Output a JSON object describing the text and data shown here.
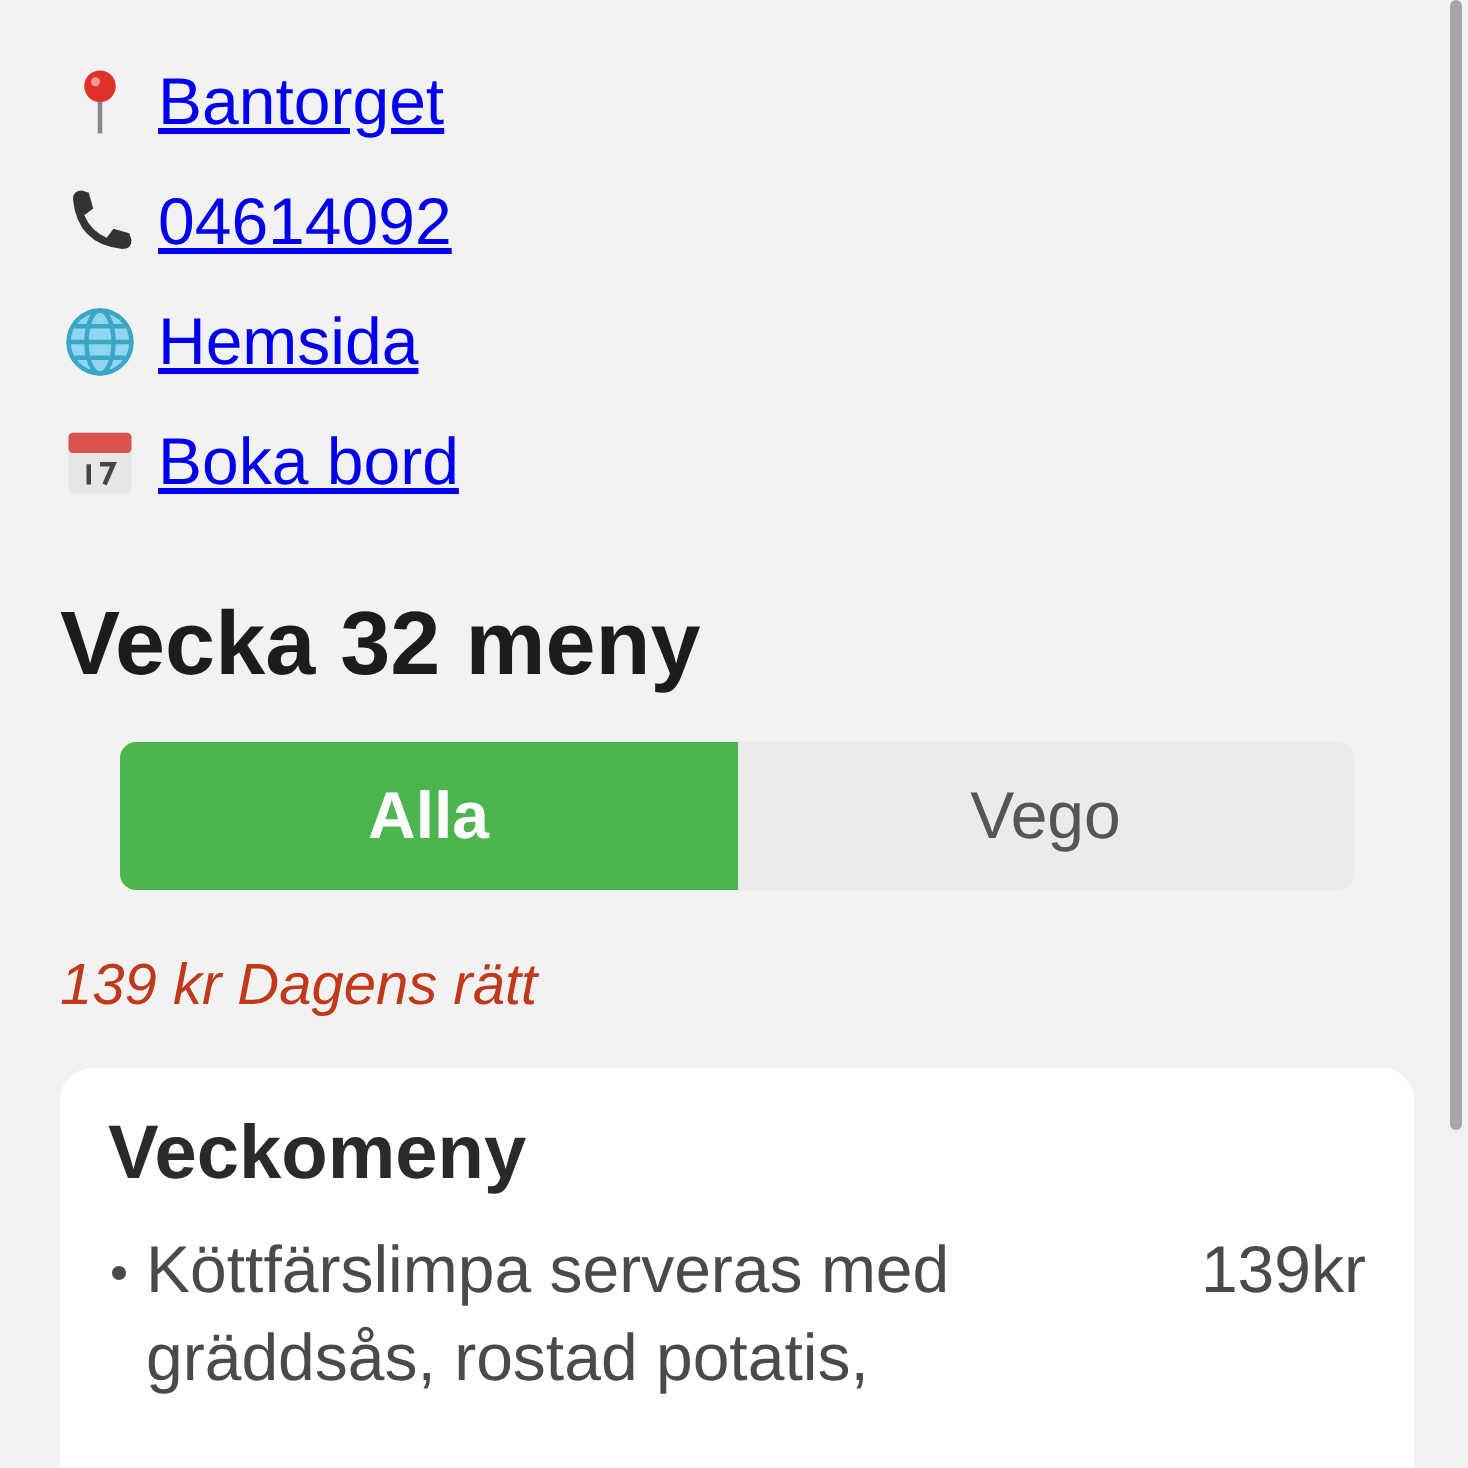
{
  "links": [
    {
      "kind": "pin",
      "label": "Bantorget"
    },
    {
      "kind": "phone",
      "label": "04614092"
    },
    {
      "kind": "globe",
      "label": "Hemsida"
    },
    {
      "kind": "calendar",
      "label": "Boka bord"
    }
  ],
  "menu_heading": "Vecka 32 meny",
  "tabs": [
    {
      "label": "Alla",
      "selected": true
    },
    {
      "label": "Vego",
      "selected": false
    }
  ],
  "daily_special": "139 kr Dagens rätt",
  "card": {
    "title": "Veckomeny",
    "items": [
      {
        "text": "Köttfärslimpa serveras med gräddsås, rostad potatis,",
        "price": "139kr"
      }
    ]
  }
}
